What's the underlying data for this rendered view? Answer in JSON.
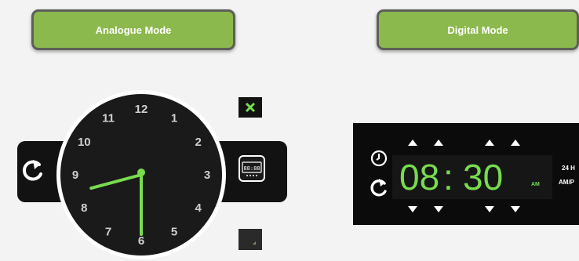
{
  "mode_buttons": {
    "analogue": "Analogue Mode",
    "digital": "Digital Mode"
  },
  "analog_clock": {
    "numerals": [
      "12",
      "1",
      "2",
      "3",
      "4",
      "5",
      "6",
      "7",
      "8",
      "9",
      "10",
      "11"
    ],
    "hour_hand_color": "#78dc4e",
    "minute_hand_color": "#78dc4e",
    "time_shown": {
      "hours": 8,
      "minutes": 30
    },
    "toggle_display": "88:88"
  },
  "digital_clock": {
    "hours": "08",
    "separator": ":",
    "minutes": "30",
    "ampm": "AM",
    "label_24h": "24 H",
    "label_ampm": "AM/P",
    "digit_color": "#78dc4e"
  },
  "colors": {
    "accent_green": "#8cb94d",
    "panel_black": "#0b0b0b"
  }
}
